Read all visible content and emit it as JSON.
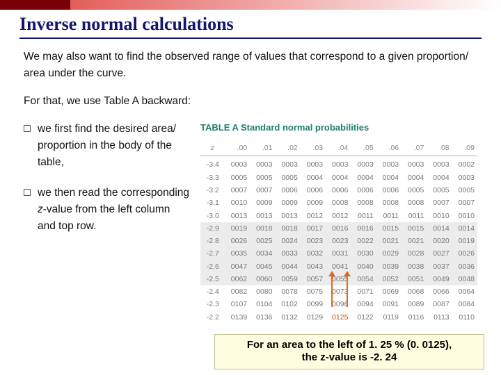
{
  "title": "Inverse normal calculations",
  "para1": "We may also want to find the observed range of values that correspond to a given proportion/ area under the curve.",
  "para2": "For that, we use Table A backward:",
  "bullet1": "we first find the desired area/ proportion in the body of the table,",
  "bullet2_a": "we then read the corresponding ",
  "bullet2_z": "z",
  "bullet2_b": "-value from the left column and top row.",
  "table_title": "TABLE A  Standard normal probabilities",
  "caption_a": "For an area to the left of 1. 25 % (0. 0125),",
  "caption_b": "the z-value is -2. 24",
  "chart_data": {
    "type": "table",
    "col_header_first": "z",
    "col_headers": [
      ".00",
      ".01",
      ".02",
      ".03",
      ".04",
      ".05",
      ".06",
      ".07",
      ".08",
      ".09"
    ],
    "rows": [
      {
        "z": "-3.4",
        "v": [
          "0003",
          "0003",
          "0003",
          "0003",
          "0003",
          "0003",
          "0003",
          "0003",
          "0003",
          "0002"
        ]
      },
      {
        "z": "-3.3",
        "v": [
          "0005",
          "0005",
          "0005",
          "0004",
          "0004",
          "0004",
          "0004",
          "0004",
          "0004",
          "0003"
        ]
      },
      {
        "z": "-3.2",
        "v": [
          "0007",
          "0007",
          "0006",
          "0006",
          "0006",
          "0006",
          "0006",
          "0005",
          "0005",
          "0005"
        ]
      },
      {
        "z": "-3.1",
        "v": [
          "0010",
          "0009",
          "0009",
          "0009",
          "0008",
          "0008",
          "0008",
          "0008",
          "0007",
          "0007"
        ]
      },
      {
        "z": "-3.0",
        "v": [
          "0013",
          "0013",
          "0013",
          "0012",
          "0012",
          "0011",
          "0011",
          "0011",
          "0010",
          "0010"
        ]
      },
      {
        "z": "-2.9",
        "v": [
          "0019",
          "0018",
          "0018",
          "0017",
          "0016",
          "0016",
          "0015",
          "0015",
          "0014",
          "0014"
        ]
      },
      {
        "z": "-2.8",
        "v": [
          "0026",
          "0025",
          "0024",
          "0023",
          "0023",
          "0022",
          "0021",
          "0021",
          "0020",
          "0019"
        ]
      },
      {
        "z": "-2.7",
        "v": [
          "0035",
          "0034",
          "0033",
          "0032",
          "0031",
          "0030",
          "0029",
          "0028",
          "0027",
          "0026"
        ]
      },
      {
        "z": "-2.6",
        "v": [
          "0047",
          "0045",
          "0044",
          "0043",
          "0041",
          "0040",
          "0039",
          "0038",
          "0037",
          "0036"
        ]
      },
      {
        "z": "-2.5",
        "v": [
          "0062",
          "0060",
          "0059",
          "0057",
          "0055",
          "0054",
          "0052",
          "0051",
          "0049",
          "0048"
        ]
      },
      {
        "z": "-2.4",
        "v": [
          "0082",
          "0080",
          "0078",
          "0075",
          "0073",
          "0071",
          "0069",
          "0068",
          "0066",
          "0064"
        ]
      },
      {
        "z": "-2.3",
        "v": [
          "0107",
          "0104",
          "0102",
          "0099",
          "0096",
          "0094",
          "0091",
          "0089",
          "0087",
          "0084"
        ]
      },
      {
        "z": "-2.2",
        "v": [
          "0139",
          "0136",
          "0132",
          "0129",
          "0125",
          "0122",
          "0119",
          "0116",
          "0113",
          "0110"
        ]
      }
    ],
    "highlight": {
      "row": 12,
      "col": 4
    }
  }
}
